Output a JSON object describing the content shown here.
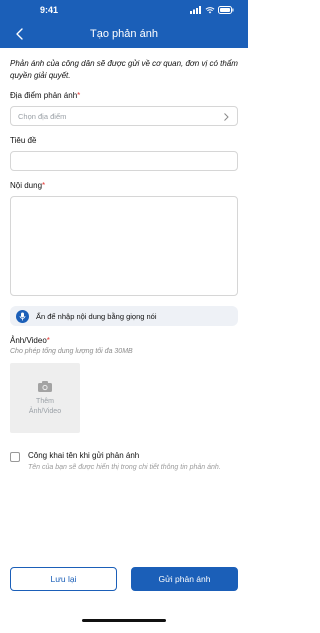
{
  "status": {
    "time": "9:41"
  },
  "header": {
    "title": "Tạo phản ánh"
  },
  "notice": "Phản ánh của công dân sẽ được gửi về cơ quan, đơn vị có thẩm quyền giải quyết.",
  "location": {
    "label": "Địa điểm phản ánh",
    "required_mark": "*",
    "placeholder": "Chọn địa điểm"
  },
  "title_field": {
    "label": "Tiêu đề",
    "value": ""
  },
  "content_field": {
    "label": "Nội dung",
    "required_mark": "*",
    "value": ""
  },
  "voice": {
    "label": "Ấn để nhập nội dung bằng giọng nói"
  },
  "media": {
    "label": "Ảnh/Video",
    "required_mark": "*",
    "hint": "Cho phép tổng dung lượng tối đa 30MB",
    "add_line1": "Thêm",
    "add_line2": "Ảnh/Video"
  },
  "public": {
    "label": "Công khai tên khi gửi phản ánh",
    "hint": "Tên của bạn sẽ được hiển thị trong chi tiết thông tin phản ánh."
  },
  "actions": {
    "save": "Lưu lại",
    "submit": "Gửi phản ánh"
  },
  "colors": {
    "primary": "#1b5fb8",
    "required": "#e53935"
  }
}
